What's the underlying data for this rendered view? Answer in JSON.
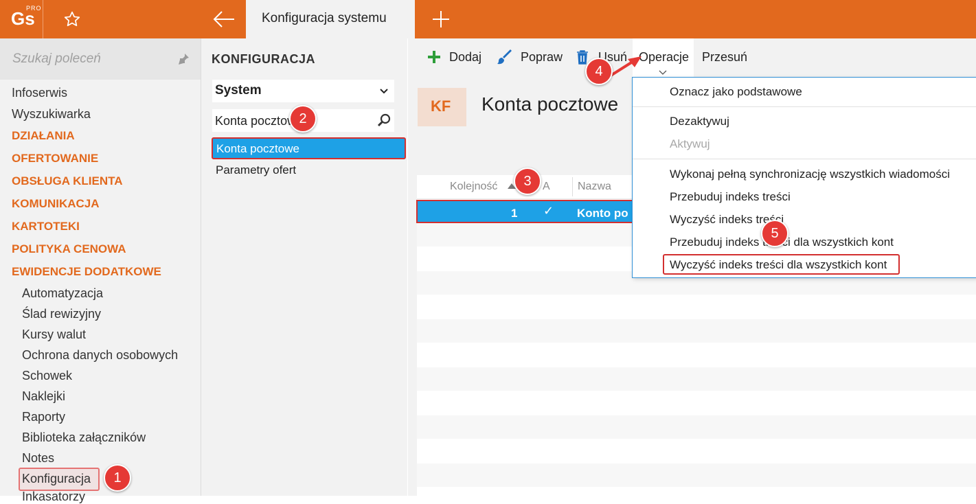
{
  "app": {
    "logo": "Gs",
    "logo_sup": "PRO",
    "tab_title": "Konfiguracja systemu"
  },
  "sidebar": {
    "search_placeholder": "Szukaj poleceń",
    "top_items": [
      "Infoserwis",
      "Wyszukiwarka"
    ],
    "categories": [
      "DZIAŁANIA",
      "OFERTOWANIE",
      "OBSŁUGA KLIENTA",
      "KOMUNIKACJA",
      "KARTOTEKI",
      "POLITYKA CENOWA",
      "EWIDENCJE DODATKOWE"
    ],
    "sub_items": [
      "Automatyzacja",
      "Ślad rewizyjny",
      "Kursy walut",
      "Ochrona danych osobowych",
      "Schowek",
      "Naklejki",
      "Raporty",
      "Biblioteka załączników",
      "Notes",
      "Konfiguracja",
      "Inkasatorzy"
    ]
  },
  "middle": {
    "title": "KONFIGURACJA",
    "dropdown_value": "System",
    "filter_value": "Konta pocztowe",
    "items": [
      "Konta pocztowe",
      "Parametry ofert"
    ]
  },
  "toolbar": {
    "add": "Dodaj",
    "edit": "Popraw",
    "delete": "Usuń",
    "operations": "Operacje",
    "move": "Przesuń"
  },
  "page": {
    "badge": "KF",
    "title": "Konta pocztowe"
  },
  "grid": {
    "columns": [
      "Kolejność",
      "A",
      "Nazwa"
    ],
    "rows": [
      {
        "order": "1",
        "active": "✓",
        "name": "Konto po"
      }
    ]
  },
  "menu": {
    "items": [
      {
        "label": "Oznacz jako podstawowe",
        "disabled": false
      },
      {
        "label": "Dezaktywuj",
        "disabled": false
      },
      {
        "label": "Aktywuj",
        "disabled": true
      },
      {
        "label": "Wykonaj pełną synchronizację wszystkich wiadomości",
        "disabled": false
      },
      {
        "label": "Przebuduj indeks treści",
        "disabled": false
      },
      {
        "label": "Wyczyść indeks treści",
        "disabled": false
      },
      {
        "label": "Przebuduj indeks treści dla wszystkich kont",
        "disabled": false
      },
      {
        "label": "Wyczyść indeks treści dla wszystkich kont",
        "disabled": false
      }
    ]
  },
  "annotations": [
    "1",
    "2",
    "3",
    "4",
    "5"
  ],
  "colors": {
    "accent": "#e2691e",
    "selection": "#1ea1e6",
    "highlight": "#d32f2f",
    "add_icon": "#2e9e3a"
  }
}
